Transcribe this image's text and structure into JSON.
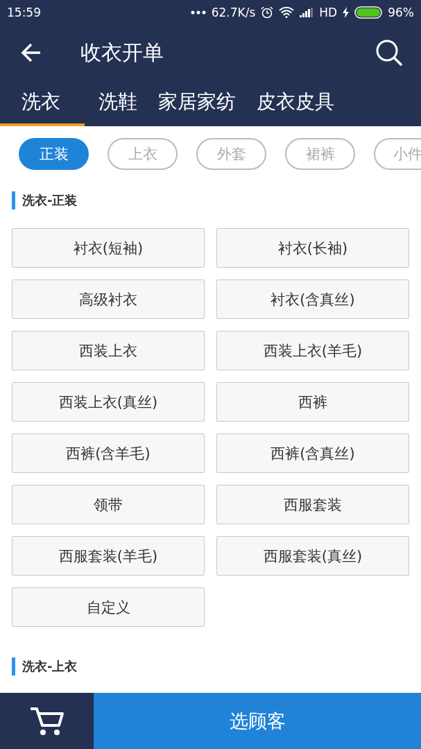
{
  "status_bar": {
    "time": "15:59",
    "network_speed": "62.7K/s",
    "network_type": "HD",
    "battery": "96%"
  },
  "app_bar": {
    "title": "收衣开单"
  },
  "tabs": [
    {
      "label": "洗衣",
      "selected": true
    },
    {
      "label": "洗鞋",
      "selected": false
    },
    {
      "label": "家居家纺",
      "selected": false
    },
    {
      "label": "皮衣皮具",
      "selected": false
    }
  ],
  "chips": [
    {
      "label": "正装",
      "selected": true
    },
    {
      "label": "上衣",
      "selected": false
    },
    {
      "label": "外套",
      "selected": false
    },
    {
      "label": "裙裤",
      "selected": false
    },
    {
      "label": "小件",
      "selected": false
    }
  ],
  "sections": [
    {
      "title": "洗衣-正装",
      "items": [
        "衬衣(短袖)",
        "衬衣(长袖)",
        "高级衬衣",
        "衬衣(含真丝)",
        "西装上衣",
        "西装上衣(羊毛)",
        "西装上衣(真丝)",
        "西裤",
        "西裤(含羊毛)",
        "西裤(含真丝)",
        "领带",
        "西服套装",
        "西服套装(羊毛)",
        "西服套装(真丝)",
        "自定义"
      ]
    },
    {
      "title": "洗衣-上衣"
    }
  ],
  "bottom_bar": {
    "button": "选顾客"
  }
}
